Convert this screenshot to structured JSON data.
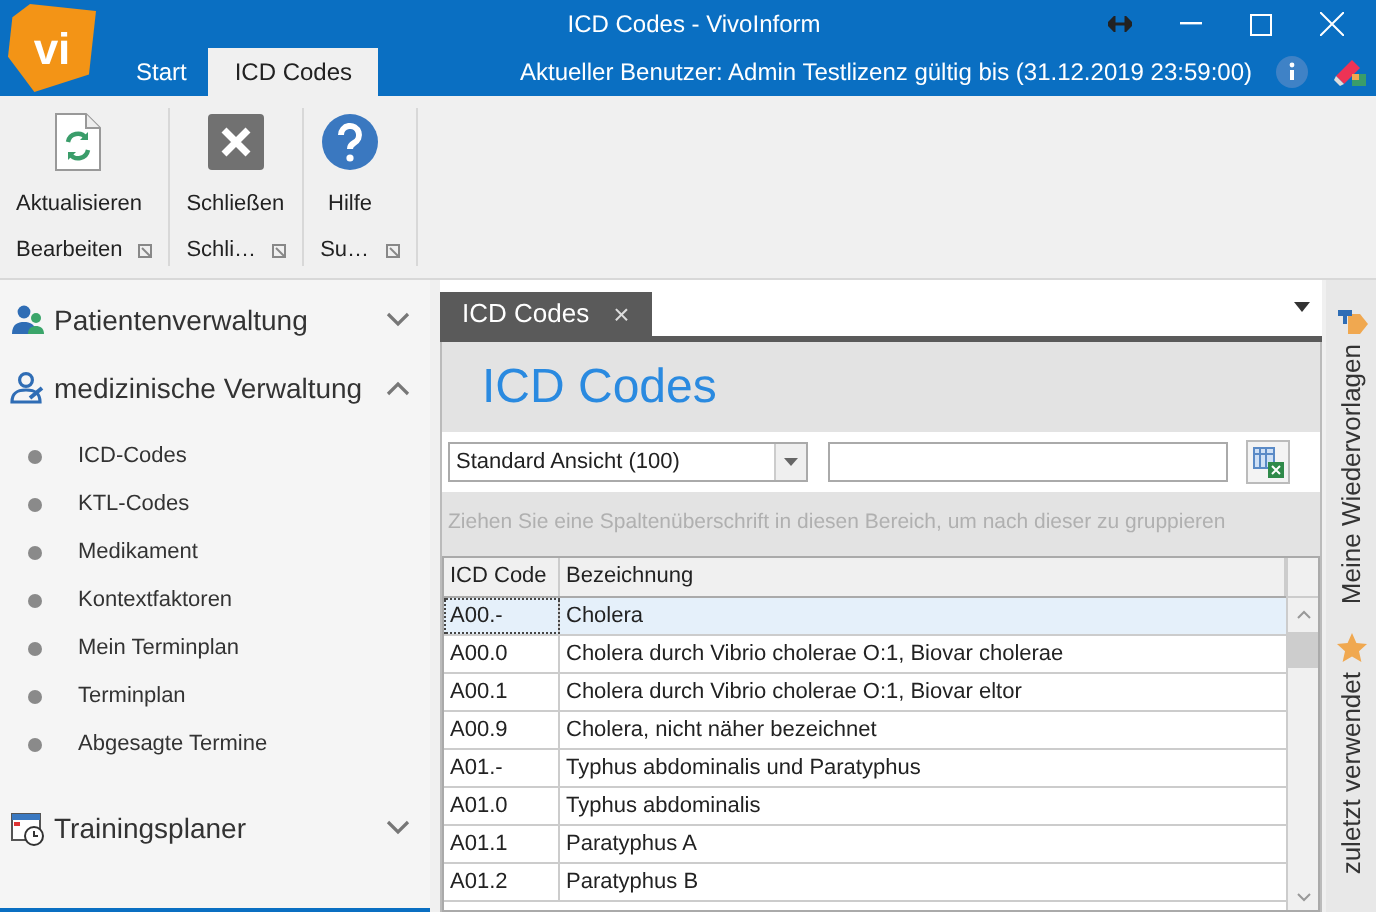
{
  "window": {
    "title": "ICD Codes - VivoInform",
    "logo": "vi"
  },
  "ribbon_tabs": [
    {
      "label": "Start",
      "selected": false
    },
    {
      "label": "ICD Codes",
      "selected": true
    }
  ],
  "user_info": "Aktueller Benutzer: Admin Testlizenz gültig bis (31.12.2019 23:59:00)",
  "ribbon_groups": [
    {
      "label": "Bearbeiten",
      "buttons": [
        {
          "label": "Aktualisieren",
          "kind": "refresh"
        }
      ]
    },
    {
      "label": "Schli…",
      "buttons": [
        {
          "label": "Schließen",
          "kind": "close"
        }
      ]
    },
    {
      "label": "Su…",
      "buttons": [
        {
          "label": "Hilfe",
          "kind": "help"
        }
      ]
    }
  ],
  "sidebar": {
    "groups": [
      {
        "label": "Patientenverwaltung",
        "kind": "patients",
        "expanded": false
      },
      {
        "label": "medizinische Verwaltung",
        "kind": "medical",
        "expanded": true,
        "items": [
          "ICD-Codes",
          "KTL-Codes",
          "Medikament",
          "Kontextfaktoren",
          "Mein Terminplan",
          "Terminplan",
          "Abgesagte Termine"
        ]
      },
      {
        "label": "Trainingsplaner",
        "kind": "calendar",
        "expanded": false
      }
    ]
  },
  "document_tab": {
    "label": "ICD Codes",
    "close": "×"
  },
  "page_title": "ICD Codes",
  "view_select": {
    "value": "Standard Ansicht (100)"
  },
  "group_panel_hint": "Ziehen Sie eine Spaltenüberschrift in diesen Bereich, um nach dieser zu gruppieren",
  "table": {
    "columns": [
      "ICD Code",
      "Bezeichnung"
    ],
    "rows": [
      {
        "code": "A00.-",
        "name": "Cholera",
        "selected": true
      },
      {
        "code": "A00.0",
        "name": "Cholera durch Vibrio cholerae O:1, Biovar cholerae",
        "selected": false
      },
      {
        "code": "A00.1",
        "name": "Cholera durch Vibrio cholerae O:1, Biovar eltor",
        "selected": false
      },
      {
        "code": "A00.9",
        "name": "Cholera, nicht näher bezeichnet",
        "selected": false
      },
      {
        "code": "A01.-",
        "name": "Typhus abdominalis und Paratyphus",
        "selected": false
      },
      {
        "code": "A01.0",
        "name": "Typhus abdominalis",
        "selected": false
      },
      {
        "code": "A01.1",
        "name": "Paratyphus A",
        "selected": false
      },
      {
        "code": "A01.2",
        "name": "Paratyphus B",
        "selected": false
      }
    ]
  },
  "right_panel": [
    {
      "label": "Meine Wiedervorlagen",
      "kind": "pin"
    },
    {
      "label": "zuletzt verwendet",
      "kind": "star"
    }
  ]
}
